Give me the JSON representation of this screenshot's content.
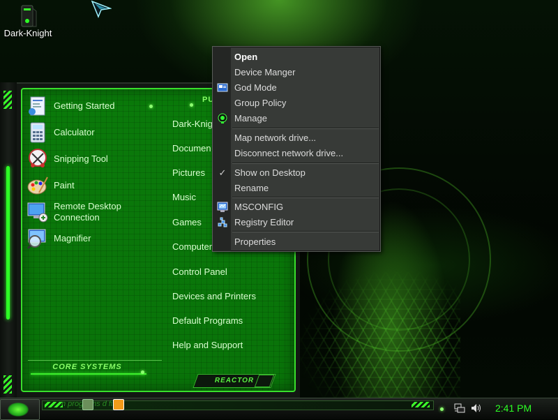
{
  "desktop": {
    "icon_label": "Dark-Knight",
    "accent_color": "#2dff25"
  },
  "start_menu": {
    "pinned_programs": [
      {
        "label": "Getting Started",
        "icon": "getting-started-icon"
      },
      {
        "label": "Calculator",
        "icon": "calculator-icon"
      },
      {
        "label": "Snipping Tool",
        "icon": "scissors-icon"
      },
      {
        "label": "Paint",
        "icon": "paint-palette-icon"
      },
      {
        "label": "Remote Desktop",
        "label_line2": "Connection",
        "icon": "remote-desktop-icon"
      },
      {
        "label": "Magnifier",
        "icon": "magnifier-icon"
      }
    ],
    "places_header": "PU",
    "places": [
      {
        "label": "Dark-Knig"
      },
      {
        "label": "Documen"
      },
      {
        "label": "Pictures"
      },
      {
        "label": "Music"
      },
      {
        "label": "Games"
      },
      {
        "label": "Computer"
      },
      {
        "label": "Control Panel"
      },
      {
        "label": "Devices and Printers"
      },
      {
        "label": "Default Programs"
      },
      {
        "label": "Help and Support"
      }
    ],
    "core_systems_label": "CORE SYSTEMS",
    "reactor_label": "REACTOR"
  },
  "context_menu": {
    "items": [
      {
        "label": "Open",
        "bold": true
      },
      {
        "label": "Device Manger"
      },
      {
        "label": "God Mode",
        "icon": "god-mode-icon"
      },
      {
        "label": "Group Policy"
      },
      {
        "label": "Manage",
        "icon": "manage-icon"
      },
      {
        "label": "Map network drive..."
      },
      {
        "label": "Disconnect network drive..."
      },
      {
        "label": "Show on Desktop",
        "checked": true
      },
      {
        "label": "Rename"
      },
      {
        "label": "MSCONFIG",
        "icon": "msconfig-icon"
      },
      {
        "label": "Registry Editor",
        "icon": "registry-editor-icon"
      },
      {
        "label": "Properties"
      }
    ]
  },
  "taskbar": {
    "search_placeholder": "n programs    d files",
    "clock": "2:41 PM"
  }
}
